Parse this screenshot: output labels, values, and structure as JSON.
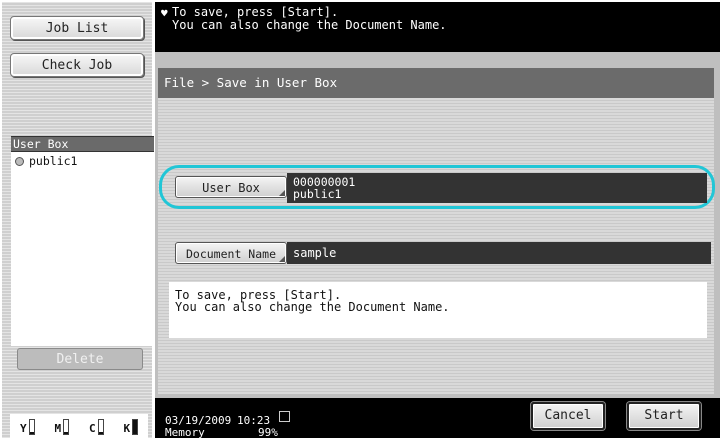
{
  "sidebar": {
    "job_list": "Job List",
    "check_job": "Check Job",
    "userbox_header": "User Box",
    "userbox_items": [
      "public1"
    ],
    "delete": "Delete"
  },
  "toner": [
    {
      "label": "Y",
      "level": 0.15
    },
    {
      "label": "M",
      "level": 0.15
    },
    {
      "label": "C",
      "level": 0.15
    },
    {
      "label": "K",
      "level": 1.0
    }
  ],
  "message": {
    "line1": "To save, press [Start].",
    "line2": "You can also change the Document Name."
  },
  "breadcrumb": "File > Save in User Box",
  "fields": {
    "userbox_label": "User Box",
    "userbox_number": "000000001",
    "userbox_name": "public1",
    "docname_label": "Document Name",
    "docname_value": "sample"
  },
  "info": {
    "line1": "To save, press [Start].",
    "line2": "You can also change the Document Name."
  },
  "status": {
    "date": "03/19/2009",
    "time": "10:23",
    "memory_label": "Memory",
    "memory_value": "99%"
  },
  "buttons": {
    "cancel": "Cancel",
    "start": "Start"
  },
  "colors": {
    "highlight": "#21c6d6",
    "dark_field": "#333333",
    "header_bar": "#6b6b6b"
  }
}
